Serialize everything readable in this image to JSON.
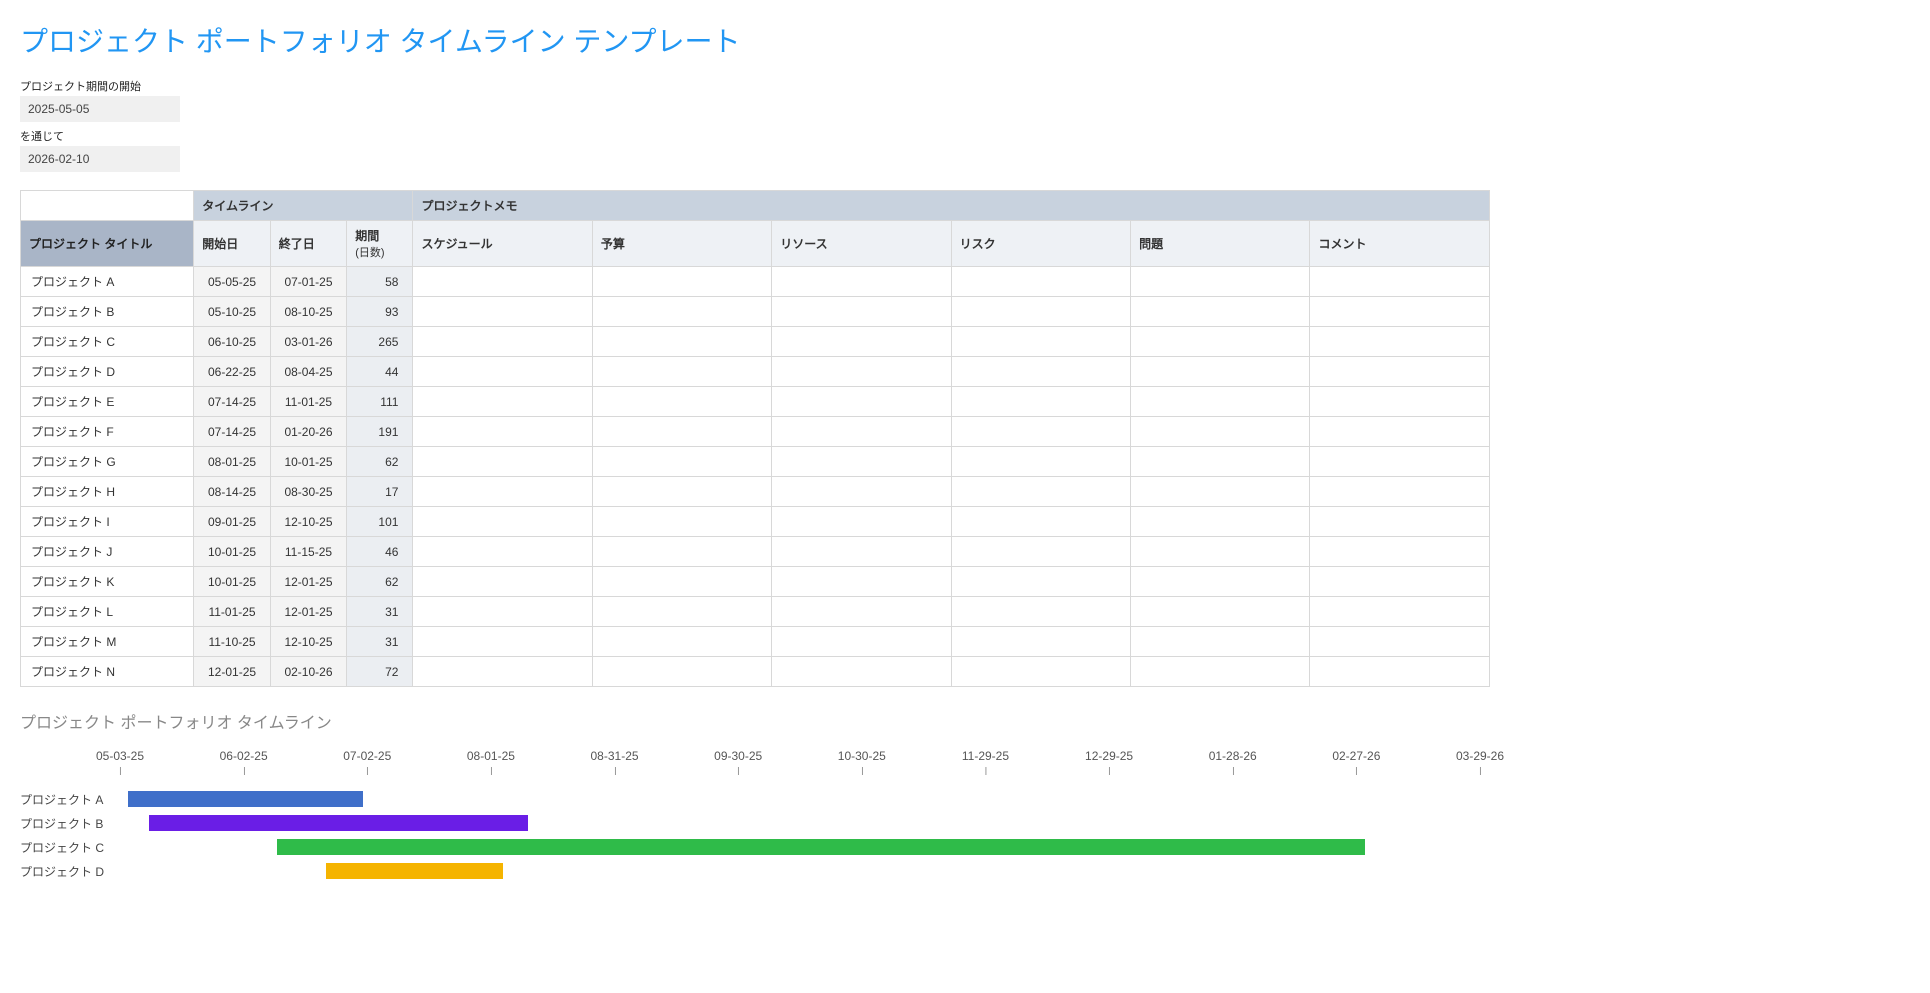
{
  "title": "プロジェクト ポートフォリオ タイムライン テンプレート",
  "period": {
    "start_label": "プロジェクト期間の開始",
    "start_value": "2025-05-05",
    "through_label": "を通じて",
    "end_value": "2026-02-10"
  },
  "table": {
    "group_headers": {
      "timeline": "タイムライン",
      "notes": "プロジェクトメモ"
    },
    "headers": {
      "project_title": "プロジェクト タイトル",
      "start": "開始日",
      "end": "終了日",
      "duration": "期間",
      "duration_sub": "(日数)",
      "schedule": "スケジュール",
      "budget": "予算",
      "resources": "リソース",
      "risk": "リスク",
      "issues": "問題",
      "comment": "コメント"
    },
    "rows": [
      {
        "name": "プロジェクト A",
        "start": "05-05-25",
        "end": "07-01-25",
        "days": "58"
      },
      {
        "name": "プロジェクト B",
        "start": "05-10-25",
        "end": "08-10-25",
        "days": "93"
      },
      {
        "name": "プロジェクト C",
        "start": "06-10-25",
        "end": "03-01-26",
        "days": "265"
      },
      {
        "name": "プロジェクト D",
        "start": "06-22-25",
        "end": "08-04-25",
        "days": "44"
      },
      {
        "name": "プロジェクト E",
        "start": "07-14-25",
        "end": "11-01-25",
        "days": "111"
      },
      {
        "name": "プロジェクト F",
        "start": "07-14-25",
        "end": "01-20-26",
        "days": "191"
      },
      {
        "name": "プロジェクト G",
        "start": "08-01-25",
        "end": "10-01-25",
        "days": "62"
      },
      {
        "name": "プロジェクト H",
        "start": "08-14-25",
        "end": "08-30-25",
        "days": "17"
      },
      {
        "name": "プロジェクト I",
        "start": "09-01-25",
        "end": "12-10-25",
        "days": "101"
      },
      {
        "name": "プロジェクト J",
        "start": "10-01-25",
        "end": "11-15-25",
        "days": "46"
      },
      {
        "name": "プロジェクト K",
        "start": "10-01-25",
        "end": "12-01-25",
        "days": "62"
      },
      {
        "name": "プロジェクト L",
        "start": "11-01-25",
        "end": "12-01-25",
        "days": "31"
      },
      {
        "name": "プロジェクト M",
        "start": "11-10-25",
        "end": "12-10-25",
        "days": "31"
      },
      {
        "name": "プロジェクト N",
        "start": "12-01-25",
        "end": "02-10-26",
        "days": "72"
      }
    ]
  },
  "gantt": {
    "title": "プロジェクト ポートフォリオ タイムライン",
    "axis_start": "2025-05-03",
    "axis_end": "2026-03-29",
    "ticks": [
      "05-03-25",
      "06-02-25",
      "07-02-25",
      "08-01-25",
      "08-31-25",
      "09-30-25",
      "10-30-25",
      "11-29-25",
      "12-29-25",
      "01-28-26",
      "02-27-26",
      "03-29-26"
    ],
    "rows": [
      {
        "label": "プロジェクト A",
        "start": "2025-05-05",
        "end": "2025-07-01",
        "color": "#3f6fc9"
      },
      {
        "label": "プロジェクト B",
        "start": "2025-05-10",
        "end": "2025-08-10",
        "color": "#6a1ee6"
      },
      {
        "label": "プロジェクト C",
        "start": "2025-06-10",
        "end": "2026-03-01",
        "color": "#2fbb49"
      },
      {
        "label": "プロジェクト D",
        "start": "2025-06-22",
        "end": "2025-08-04",
        "color": "#f5b400"
      }
    ]
  },
  "chart_data": {
    "type": "bar",
    "title": "プロジェクト ポートフォリオ タイムライン",
    "orientation": "horizontal-gantt",
    "x_axis_ticks": [
      "05-03-25",
      "06-02-25",
      "07-02-25",
      "08-01-25",
      "08-31-25",
      "09-30-25",
      "10-30-25",
      "11-29-25",
      "12-29-25",
      "01-28-26",
      "02-27-26",
      "03-29-26"
    ],
    "x_range": [
      "2025-05-03",
      "2026-03-29"
    ],
    "categories": [
      "プロジェクト A",
      "プロジェクト B",
      "プロジェクト C",
      "プロジェクト D"
    ],
    "series": [
      {
        "name": "プロジェクト A",
        "start": "2025-05-05",
        "end": "2025-07-01",
        "color": "#3f6fc9"
      },
      {
        "name": "プロジェクト B",
        "start": "2025-05-10",
        "end": "2025-08-10",
        "color": "#6a1ee6"
      },
      {
        "name": "プロジェクト C",
        "start": "2025-06-10",
        "end": "2026-03-01",
        "color": "#2fbb49"
      },
      {
        "name": "プロジェクト D",
        "start": "2025-06-22",
        "end": "2025-08-04",
        "color": "#f5b400"
      }
    ]
  }
}
